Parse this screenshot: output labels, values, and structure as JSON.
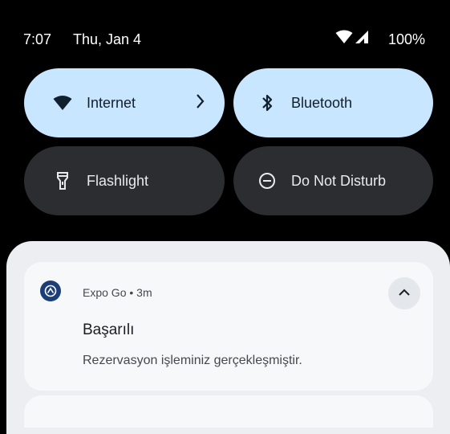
{
  "status_bar": {
    "time": "7:07",
    "date": "Thu, Jan 4",
    "battery": "100%",
    "icons": [
      "wifi-icon",
      "cellular-signal-icon"
    ]
  },
  "quick_settings": {
    "tiles": [
      {
        "label": "Internet",
        "icon": "wifi-icon",
        "state": "on",
        "has_chevron": true
      },
      {
        "label": "Bluetooth",
        "icon": "bluetooth-icon",
        "state": "on"
      },
      {
        "label": "Flashlight",
        "icon": "flashlight-icon",
        "state": "off"
      },
      {
        "label": "Do Not Disturb",
        "icon": "do-not-disturb-icon",
        "state": "off"
      }
    ]
  },
  "notification": {
    "app_name": "Expo Go",
    "separator": "•",
    "age": "3m",
    "meta": "Expo Go • 3m",
    "title": "Başarılı",
    "body": "Rezervasyon işleminiz gerçekleşmiştir.",
    "app_icon": "expo-go-icon",
    "expand_icon": "chevron-up-icon"
  },
  "colors": {
    "background": "#000000",
    "tile_on": "#c8e6ff",
    "tile_off": "#2b2d30",
    "sheet": "#eceef1",
    "card": "#f7f8fa",
    "app_icon": "#1b3d78"
  }
}
